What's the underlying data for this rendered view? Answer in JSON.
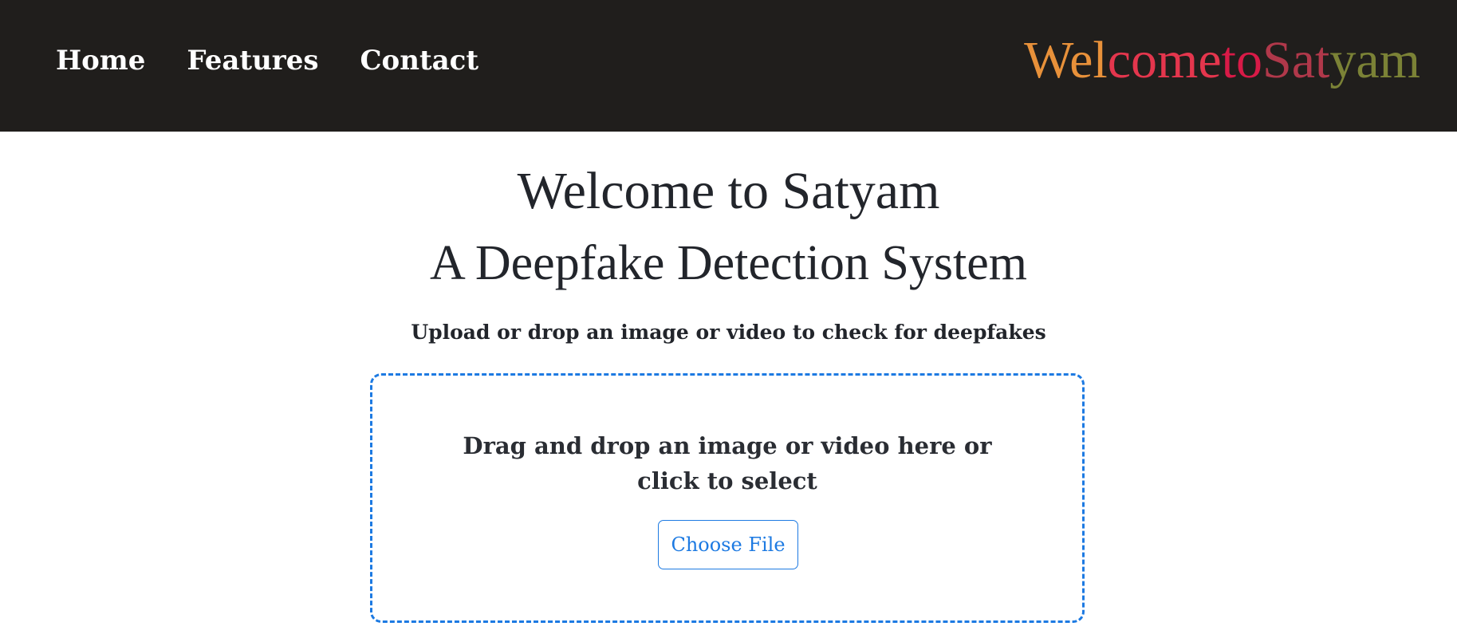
{
  "nav": {
    "links": [
      {
        "label": "Home"
      },
      {
        "label": "Features"
      },
      {
        "label": "Contact"
      }
    ],
    "brand": {
      "parts": [
        "Wel",
        "come ",
        "to",
        " Sat",
        "yam"
      ]
    }
  },
  "hero": {
    "title": "Welcome to Satyam",
    "subtitle": "A Deepfake Detection System"
  },
  "upload": {
    "instruction": "Upload or drop an image or video to check for deepfakes",
    "dropzone_text": "Drag and drop an image or video here or click to select",
    "choose_label": "Choose File"
  },
  "colors": {
    "navbar_bg": "#201e1c",
    "accent": "#1d7ae2",
    "text": "#22252b",
    "brand_gradient": [
      "#e8913a",
      "#e4364d",
      "#d81a47",
      "#b0384a",
      "#7b8236"
    ]
  }
}
